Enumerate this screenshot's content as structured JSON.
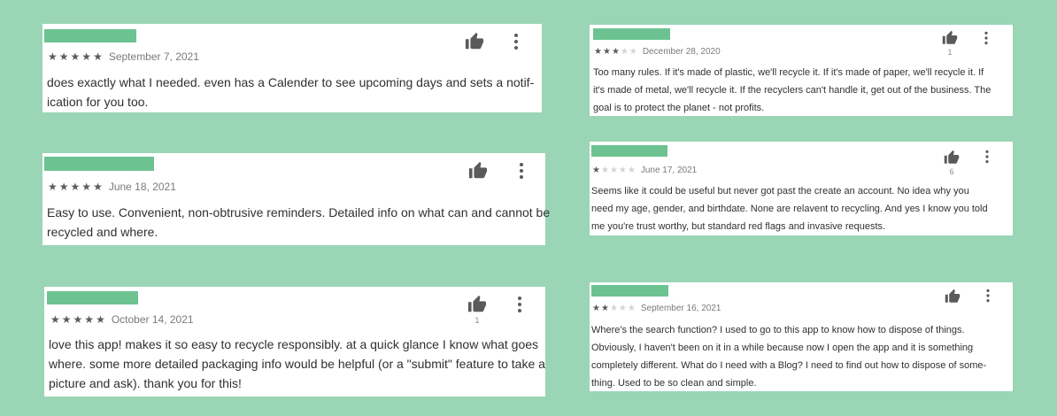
{
  "colors": {
    "background": "#9ad5b6",
    "name_placeholder": "#6cc391",
    "star_filled": "#5b5b5b",
    "star_empty": "#d4d4d4"
  },
  "reviews": [
    {
      "rating": 5,
      "date": "September 7, 2021",
      "likes": "",
      "lines": [
        "does exactly what I needed. even has a Calender to see upcoming days and sets a notif-",
        "ication for you too."
      ]
    },
    {
      "rating": 5,
      "date": "June 18, 2021",
      "likes": "",
      "lines": [
        "Easy to use. Convenient, non-obtrusive reminders. Detailed info on what can and cannot be",
        "recycled and where."
      ]
    },
    {
      "rating": 5,
      "date": "October 14, 2021",
      "likes": "1",
      "lines": [
        "love this app! makes it so easy to recycle responsibly. at a quick glance I know what goes",
        "where. some more detailed packaging info would be helpful (or a \"submit\" feature to take a",
        "picture and ask). thank you for this!"
      ]
    },
    {
      "rating": 3,
      "date": "December 28, 2020",
      "likes": "1",
      "lines": [
        "Too many rules. If it's made of plastic, we'll recycle it. If it's made of paper, we'll recycle it. If",
        "it's made of metal, we'll recycle it. If the recyclers can't handle it, get out of the business. The",
        "goal is to protect the planet - not profits."
      ]
    },
    {
      "rating": 1,
      "date": "June 17, 2021",
      "likes": "6",
      "lines": [
        "Seems like it could be useful but never got past the create an account. No idea why you",
        "need my age, gender, and birthdate. None are relavent to recycling. And yes I know you told",
        "me you're trust worthy, but standard red flags and invasive requests."
      ]
    },
    {
      "rating": 2,
      "date": "September 16, 2021",
      "likes": "",
      "lines": [
        "Where's the search function? I used to go to this app to know how to dispose of things.",
        "Obviously, I haven't been on it in a while because now I open the app and it is something",
        "completely different. What do I need with a Blog? I need to find out how to dispose of some-",
        "thing. Used to be so clean and simple."
      ]
    }
  ]
}
